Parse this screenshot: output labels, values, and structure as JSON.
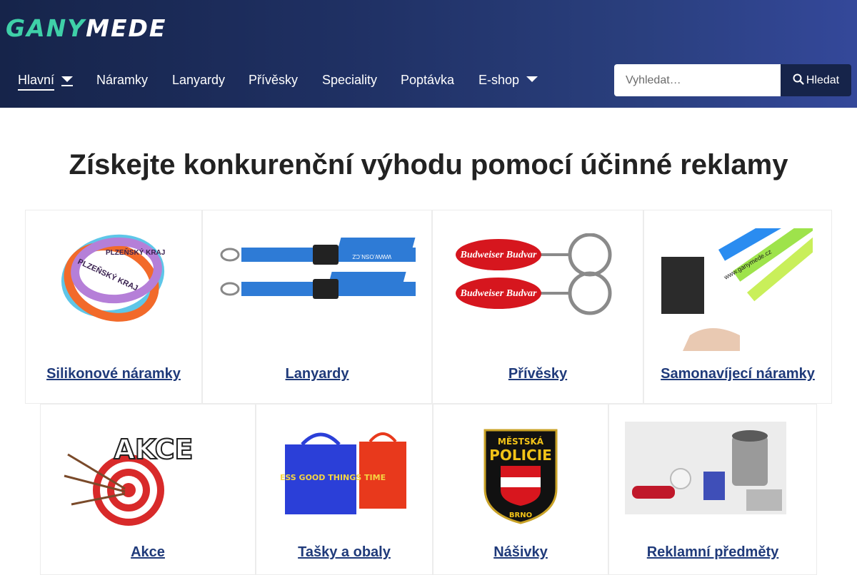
{
  "header": {
    "logo": {
      "part1": "GANY",
      "part2": "MEDE"
    },
    "nav": [
      {
        "label": "Hlavní"
      },
      {
        "label": "Náramky"
      },
      {
        "label": "Lanyardy"
      },
      {
        "label": "Přívěsky"
      },
      {
        "label": "Speciality"
      },
      {
        "label": "Poptávka"
      },
      {
        "label": "E-shop"
      }
    ],
    "search": {
      "placeholder": "Vyhledat…",
      "button_label": "Hledat"
    }
  },
  "main": {
    "headline": "Získejte konkurenční výhodu pomocí účinné reklamy",
    "products": [
      {
        "title": "Silikonové náramky",
        "image_text": "PLZEŇSKÝ KRAJ"
      },
      {
        "title": "Lanyardy",
        "image_text": "WWW.OSN.CZ"
      },
      {
        "title": "Přívěsky",
        "image_text": "Budweiser Budvar"
      },
      {
        "title": "Samonavíjecí náramky",
        "image_text": "www.ganymede.cz"
      },
      {
        "title": "Akce",
        "image_text": "AKCE"
      },
      {
        "title": "Tašky a obaly",
        "image_text": "PROCESS GOOD THINGS TIME"
      },
      {
        "title": "Nášivky",
        "image_text": "MĚSTSKÁ POLICIE BRNO"
      },
      {
        "title": "Reklamní předměty"
      }
    ]
  },
  "colors": {
    "header_dark": "#16244a",
    "header_light": "#34489a",
    "accent_logo": "#3fd0a8",
    "link": "#1f3a7a"
  }
}
